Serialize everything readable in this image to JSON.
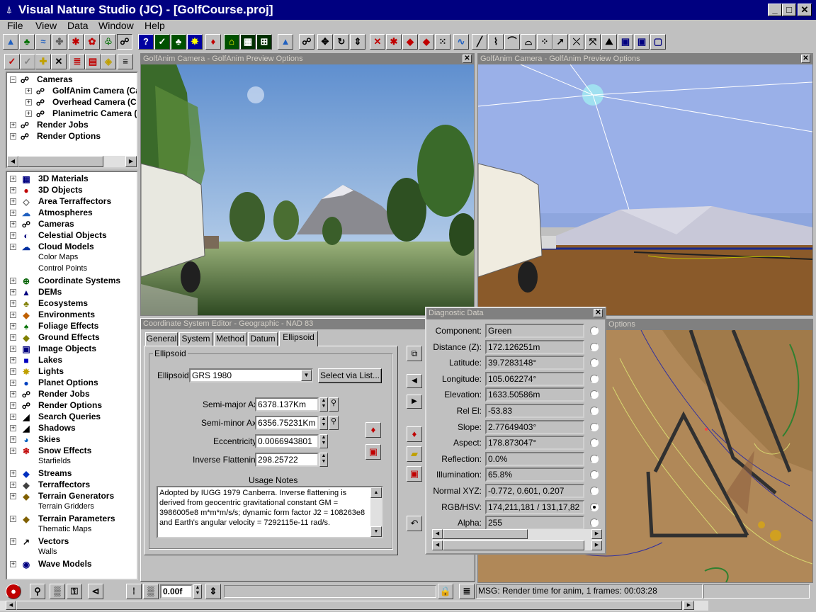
{
  "app": {
    "title": "Visual Nature Studio (JC) - [GolfCourse.proj]",
    "window_buttons": {
      "min": "_",
      "max": "□",
      "close": "✕"
    }
  },
  "menu": [
    "File",
    "View",
    "Data",
    "Window",
    "Help"
  ],
  "camera_tree": {
    "items": [
      {
        "label": "Cameras",
        "expander": "−",
        "indent": 0
      },
      {
        "label": "GolfAnim Camera (Ca",
        "expander": "+",
        "indent": 1
      },
      {
        "label": "Overhead Camera (C",
        "expander": "+",
        "indent": 1
      },
      {
        "label": "Planimetric Camera (I",
        "expander": "+",
        "indent": 1
      },
      {
        "label": "Render Jobs",
        "expander": "+",
        "indent": 0
      },
      {
        "label": "Render Options",
        "expander": "+",
        "indent": 0
      }
    ]
  },
  "library": {
    "items": [
      {
        "label": "3D Materials",
        "expander": "+",
        "style": "bold",
        "icon": "▦",
        "color": "#000080"
      },
      {
        "label": "3D Objects",
        "expander": "+",
        "style": "bold",
        "icon": "●",
        "color": "#c00000"
      },
      {
        "label": "Area Terraffectors",
        "expander": "+",
        "style": "bold",
        "icon": "◇",
        "color": "#606060"
      },
      {
        "label": "Atmospheres",
        "expander": "+",
        "style": "bold",
        "icon": "☁",
        "color": "#2060c0"
      },
      {
        "label": "Cameras",
        "expander": "+",
        "style": "bold",
        "icon": "☍",
        "color": "#000"
      },
      {
        "label": "Celestial Objects",
        "expander": "+",
        "style": "bold",
        "icon": "◐",
        "color": "#000080"
      },
      {
        "label": "Cloud Models",
        "expander": "+",
        "style": "bold",
        "icon": "☁",
        "color": "#0030a0"
      },
      {
        "label": "Color Maps",
        "expander": "",
        "style": "light",
        "icon": "",
        "color": "#000"
      },
      {
        "label": "Control Points",
        "expander": "",
        "style": "light",
        "icon": "",
        "color": "#000"
      },
      {
        "label": "Coordinate Systems",
        "expander": "+",
        "style": "bold",
        "icon": "⊕",
        "color": "#006000"
      },
      {
        "label": "DEMs",
        "expander": "+",
        "style": "bold",
        "icon": "▲",
        "color": "#000080"
      },
      {
        "label": "Ecosystems",
        "expander": "+",
        "style": "bold",
        "icon": "♣",
        "color": "#808000"
      },
      {
        "label": "Environments",
        "expander": "+",
        "style": "bold",
        "icon": "◆",
        "color": "#c06000"
      },
      {
        "label": "Foliage Effects",
        "expander": "+",
        "style": "bold",
        "icon": "♠",
        "color": "#007000"
      },
      {
        "label": "Ground Effects",
        "expander": "+",
        "style": "bold",
        "icon": "◆",
        "color": "#808000"
      },
      {
        "label": "Image Objects",
        "expander": "+",
        "style": "bold",
        "icon": "▣",
        "color": "#000080"
      },
      {
        "label": "Lakes",
        "expander": "+",
        "style": "bold",
        "icon": "■",
        "color": "#0000c0"
      },
      {
        "label": "Lights",
        "expander": "+",
        "style": "bold",
        "icon": "✸",
        "color": "#c0a000"
      },
      {
        "label": "Planet Options",
        "expander": "+",
        "style": "bold",
        "icon": "●",
        "color": "#0040c0"
      },
      {
        "label": "Render Jobs",
        "expander": "+",
        "style": "bold",
        "icon": "☍",
        "color": "#000"
      },
      {
        "label": "Render Options",
        "expander": "+",
        "style": "bold",
        "icon": "☍",
        "color": "#000"
      },
      {
        "label": "Search Queries",
        "expander": "+",
        "style": "bold",
        "icon": "◢",
        "color": "#000"
      },
      {
        "label": "Shadows",
        "expander": "+",
        "style": "bold",
        "icon": "◢",
        "color": "#000"
      },
      {
        "label": "Skies",
        "expander": "+",
        "style": "bold",
        "icon": "◕",
        "color": "#0060c0"
      },
      {
        "label": "Snow Effects",
        "expander": "+",
        "style": "bold",
        "icon": "❄",
        "color": "#c00000"
      },
      {
        "label": "Starfields",
        "expander": "",
        "style": "light",
        "icon": "",
        "color": "#000"
      },
      {
        "label": "Streams",
        "expander": "+",
        "style": "bold",
        "icon": "◆",
        "color": "#0030c0"
      },
      {
        "label": "Terraffectors",
        "expander": "+",
        "style": "bold",
        "icon": "◆",
        "color": "#404040"
      },
      {
        "label": "Terrain Generators",
        "expander": "+",
        "style": "bold",
        "icon": "◆",
        "color": "#806000"
      },
      {
        "label": "Terrain Gridders",
        "expander": "",
        "style": "light",
        "icon": "",
        "color": "#000"
      },
      {
        "label": "Terrain Parameters",
        "expander": "+",
        "style": "bold",
        "icon": "◆",
        "color": "#806000"
      },
      {
        "label": "Thematic Maps",
        "expander": "",
        "style": "light",
        "icon": "",
        "color": "#000"
      },
      {
        "label": "Vectors",
        "expander": "+",
        "style": "bold",
        "icon": "↗",
        "color": "#000"
      },
      {
        "label": "Walls",
        "expander": "",
        "style": "light",
        "icon": "",
        "color": "#000"
      },
      {
        "label": "Wave Models",
        "expander": "+",
        "style": "bold",
        "icon": "◉",
        "color": "#000080"
      }
    ]
  },
  "views": {
    "view1_title": "GolfAnim Camera - GolfAnim Preview Options",
    "view2_title": "GolfAnim Camera - GolfAnim Preview Options",
    "view3_title_tail": "Options"
  },
  "cs_editor": {
    "title": "Coordinate System Editor - Geographic - NAD 83",
    "tabs": [
      "General",
      "System",
      "Method",
      "Datum",
      "Ellipsoid"
    ],
    "active_tab": "Ellipsoid",
    "group_label": "Ellipsoid",
    "ellipsoid_label": "Ellipsoid",
    "ellipsoid_value": "GRS 1980",
    "select_button": "Select via List...",
    "semi_major_label": "Semi-major Axis",
    "semi_major_value": "6378.137Km",
    "semi_minor_label": "Semi-minor Axis",
    "semi_minor_value": "6356.75231Km",
    "eccentricity_label": "Eccentricity",
    "eccentricity_value": "0.0066943801",
    "inverse_flattening_label": "Inverse Flattening",
    "inverse_flattening_value": "298.25722",
    "usage_label": "Usage Notes",
    "usage_text": "Adopted by IUGG 1979 Canberra.  Inverse flattening is derived from geocentric gravitational constant GM = 3986005e8 m*m*m/s/s; dynamic form factor J2 = 108263e8 and Earth's angular velocity = 7292115e-11 rad/s."
  },
  "diagnostic": {
    "title": "Diagnostic Data",
    "rows": [
      {
        "label": "Component:",
        "value": "Green",
        "selected": false
      },
      {
        "label": "Distance (Z):",
        "value": "172.126251m",
        "selected": false
      },
      {
        "label": "Latitude:",
        "value": "39.7283148°",
        "selected": false
      },
      {
        "label": "Longitude:",
        "value": "105.062274°",
        "selected": false
      },
      {
        "label": "Elevation:",
        "value": "1633.50586m",
        "selected": false
      },
      {
        "label": "Rel El:",
        "value": "-53.83",
        "selected": false
      },
      {
        "label": "Slope:",
        "value": "2.77649403°",
        "selected": false
      },
      {
        "label": "Aspect:",
        "value": "178.873047°",
        "selected": false
      },
      {
        "label": "Reflection:",
        "value": "0.0%",
        "selected": false
      },
      {
        "label": "Illumination:",
        "value": "65.8%",
        "selected": false
      },
      {
        "label": "Normal XYZ:",
        "value": "-0.772, 0.601, 0.207",
        "selected": false
      },
      {
        "label": "RGB/HSV:",
        "value": "174,211,181 / 131,17,82",
        "selected": true
      },
      {
        "label": "Alpha:",
        "value": "255",
        "selected": false
      }
    ]
  },
  "statusbar": {
    "frame_value": "0.00f",
    "message": "MSG: Render time for anim, 1 frames:   00:03:28"
  }
}
